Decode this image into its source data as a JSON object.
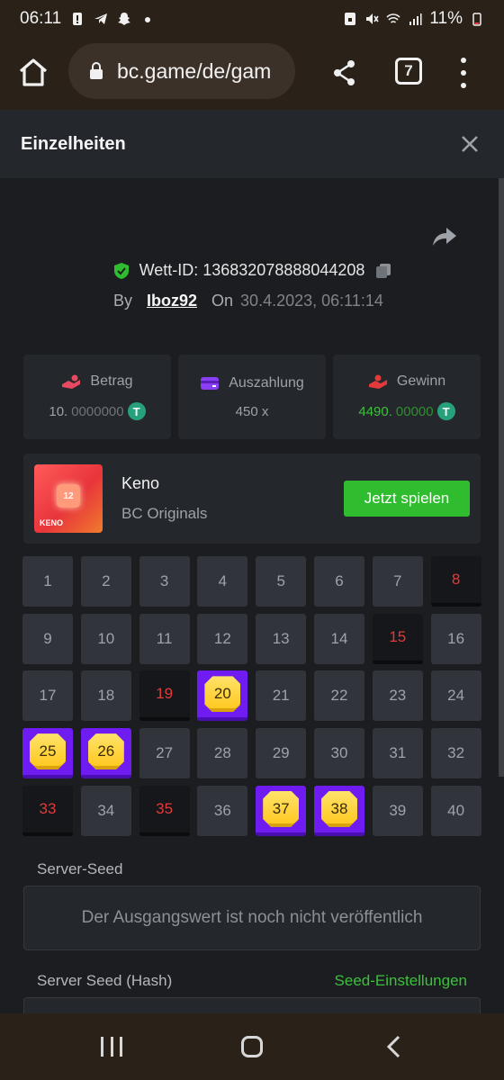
{
  "status_bar": {
    "time": "06:11",
    "battery": "11%"
  },
  "browser": {
    "url": "bc.game/de/gam",
    "tab_count": "7"
  },
  "modal": {
    "title": "Einzelheiten"
  },
  "bet": {
    "id_text": "Wett-ID: 136832078888044208",
    "by_label": "By",
    "user": "Iboz92",
    "on_label": "On",
    "date": "30.4.2023, 06:11:14"
  },
  "stats": {
    "amount": {
      "label": "Betrag",
      "value_main": "10.",
      "value_dim": "0000000"
    },
    "payout": {
      "label": "Auszahlung",
      "value": "450 x"
    },
    "win": {
      "label": "Gewinn",
      "value_main": "4490.",
      "value_dim": "00000"
    },
    "currency_symbol": "T"
  },
  "game": {
    "name": "Keno",
    "provider": "BC Originals",
    "play_label": "Jetzt spielen",
    "thumb_number": "12",
    "thumb_logo": "KENO"
  },
  "keno": {
    "cells": [
      {
        "n": "1",
        "s": "none"
      },
      {
        "n": "2",
        "s": "none"
      },
      {
        "n": "3",
        "s": "none"
      },
      {
        "n": "4",
        "s": "none"
      },
      {
        "n": "5",
        "s": "none"
      },
      {
        "n": "6",
        "s": "none"
      },
      {
        "n": "7",
        "s": "none"
      },
      {
        "n": "8",
        "s": "miss"
      },
      {
        "n": "9",
        "s": "none"
      },
      {
        "n": "10",
        "s": "none"
      },
      {
        "n": "11",
        "s": "none"
      },
      {
        "n": "12",
        "s": "none"
      },
      {
        "n": "13",
        "s": "none"
      },
      {
        "n": "14",
        "s": "none"
      },
      {
        "n": "15",
        "s": "miss"
      },
      {
        "n": "16",
        "s": "none"
      },
      {
        "n": "17",
        "s": "none"
      },
      {
        "n": "18",
        "s": "none"
      },
      {
        "n": "19",
        "s": "miss"
      },
      {
        "n": "20",
        "s": "hit"
      },
      {
        "n": "21",
        "s": "none"
      },
      {
        "n": "22",
        "s": "none"
      },
      {
        "n": "23",
        "s": "none"
      },
      {
        "n": "24",
        "s": "none"
      },
      {
        "n": "25",
        "s": "hit"
      },
      {
        "n": "26",
        "s": "hit"
      },
      {
        "n": "27",
        "s": "none"
      },
      {
        "n": "28",
        "s": "none"
      },
      {
        "n": "29",
        "s": "none"
      },
      {
        "n": "30",
        "s": "none"
      },
      {
        "n": "31",
        "s": "none"
      },
      {
        "n": "32",
        "s": "none"
      },
      {
        "n": "33",
        "s": "miss"
      },
      {
        "n": "34",
        "s": "none"
      },
      {
        "n": "35",
        "s": "miss"
      },
      {
        "n": "36",
        "s": "none"
      },
      {
        "n": "37",
        "s": "hit"
      },
      {
        "n": "38",
        "s": "hit"
      },
      {
        "n": "39",
        "s": "none"
      },
      {
        "n": "40",
        "s": "none"
      }
    ]
  },
  "seed": {
    "server_seed_label": "Server-Seed",
    "server_seed_value": "Der Ausgangswert ist noch nicht veröffentlich",
    "hash_label": "Server Seed (Hash)",
    "settings_link": "Seed-Einstellungen"
  },
  "colors": {
    "accent_green": "#2fbd2f",
    "hit_purple": "#6f1cf2",
    "miss_red": "#e23a3a",
    "tether": "#26a17b"
  },
  "icons": [
    "home-icon",
    "lock-icon",
    "share-icon",
    "tabs-icon",
    "more-vert-icon",
    "close-icon",
    "forward-share-icon",
    "shield-check-icon",
    "copy-icon",
    "wallet-icon",
    "coins-hand-icon",
    "tether-icon",
    "gem-icon"
  ]
}
